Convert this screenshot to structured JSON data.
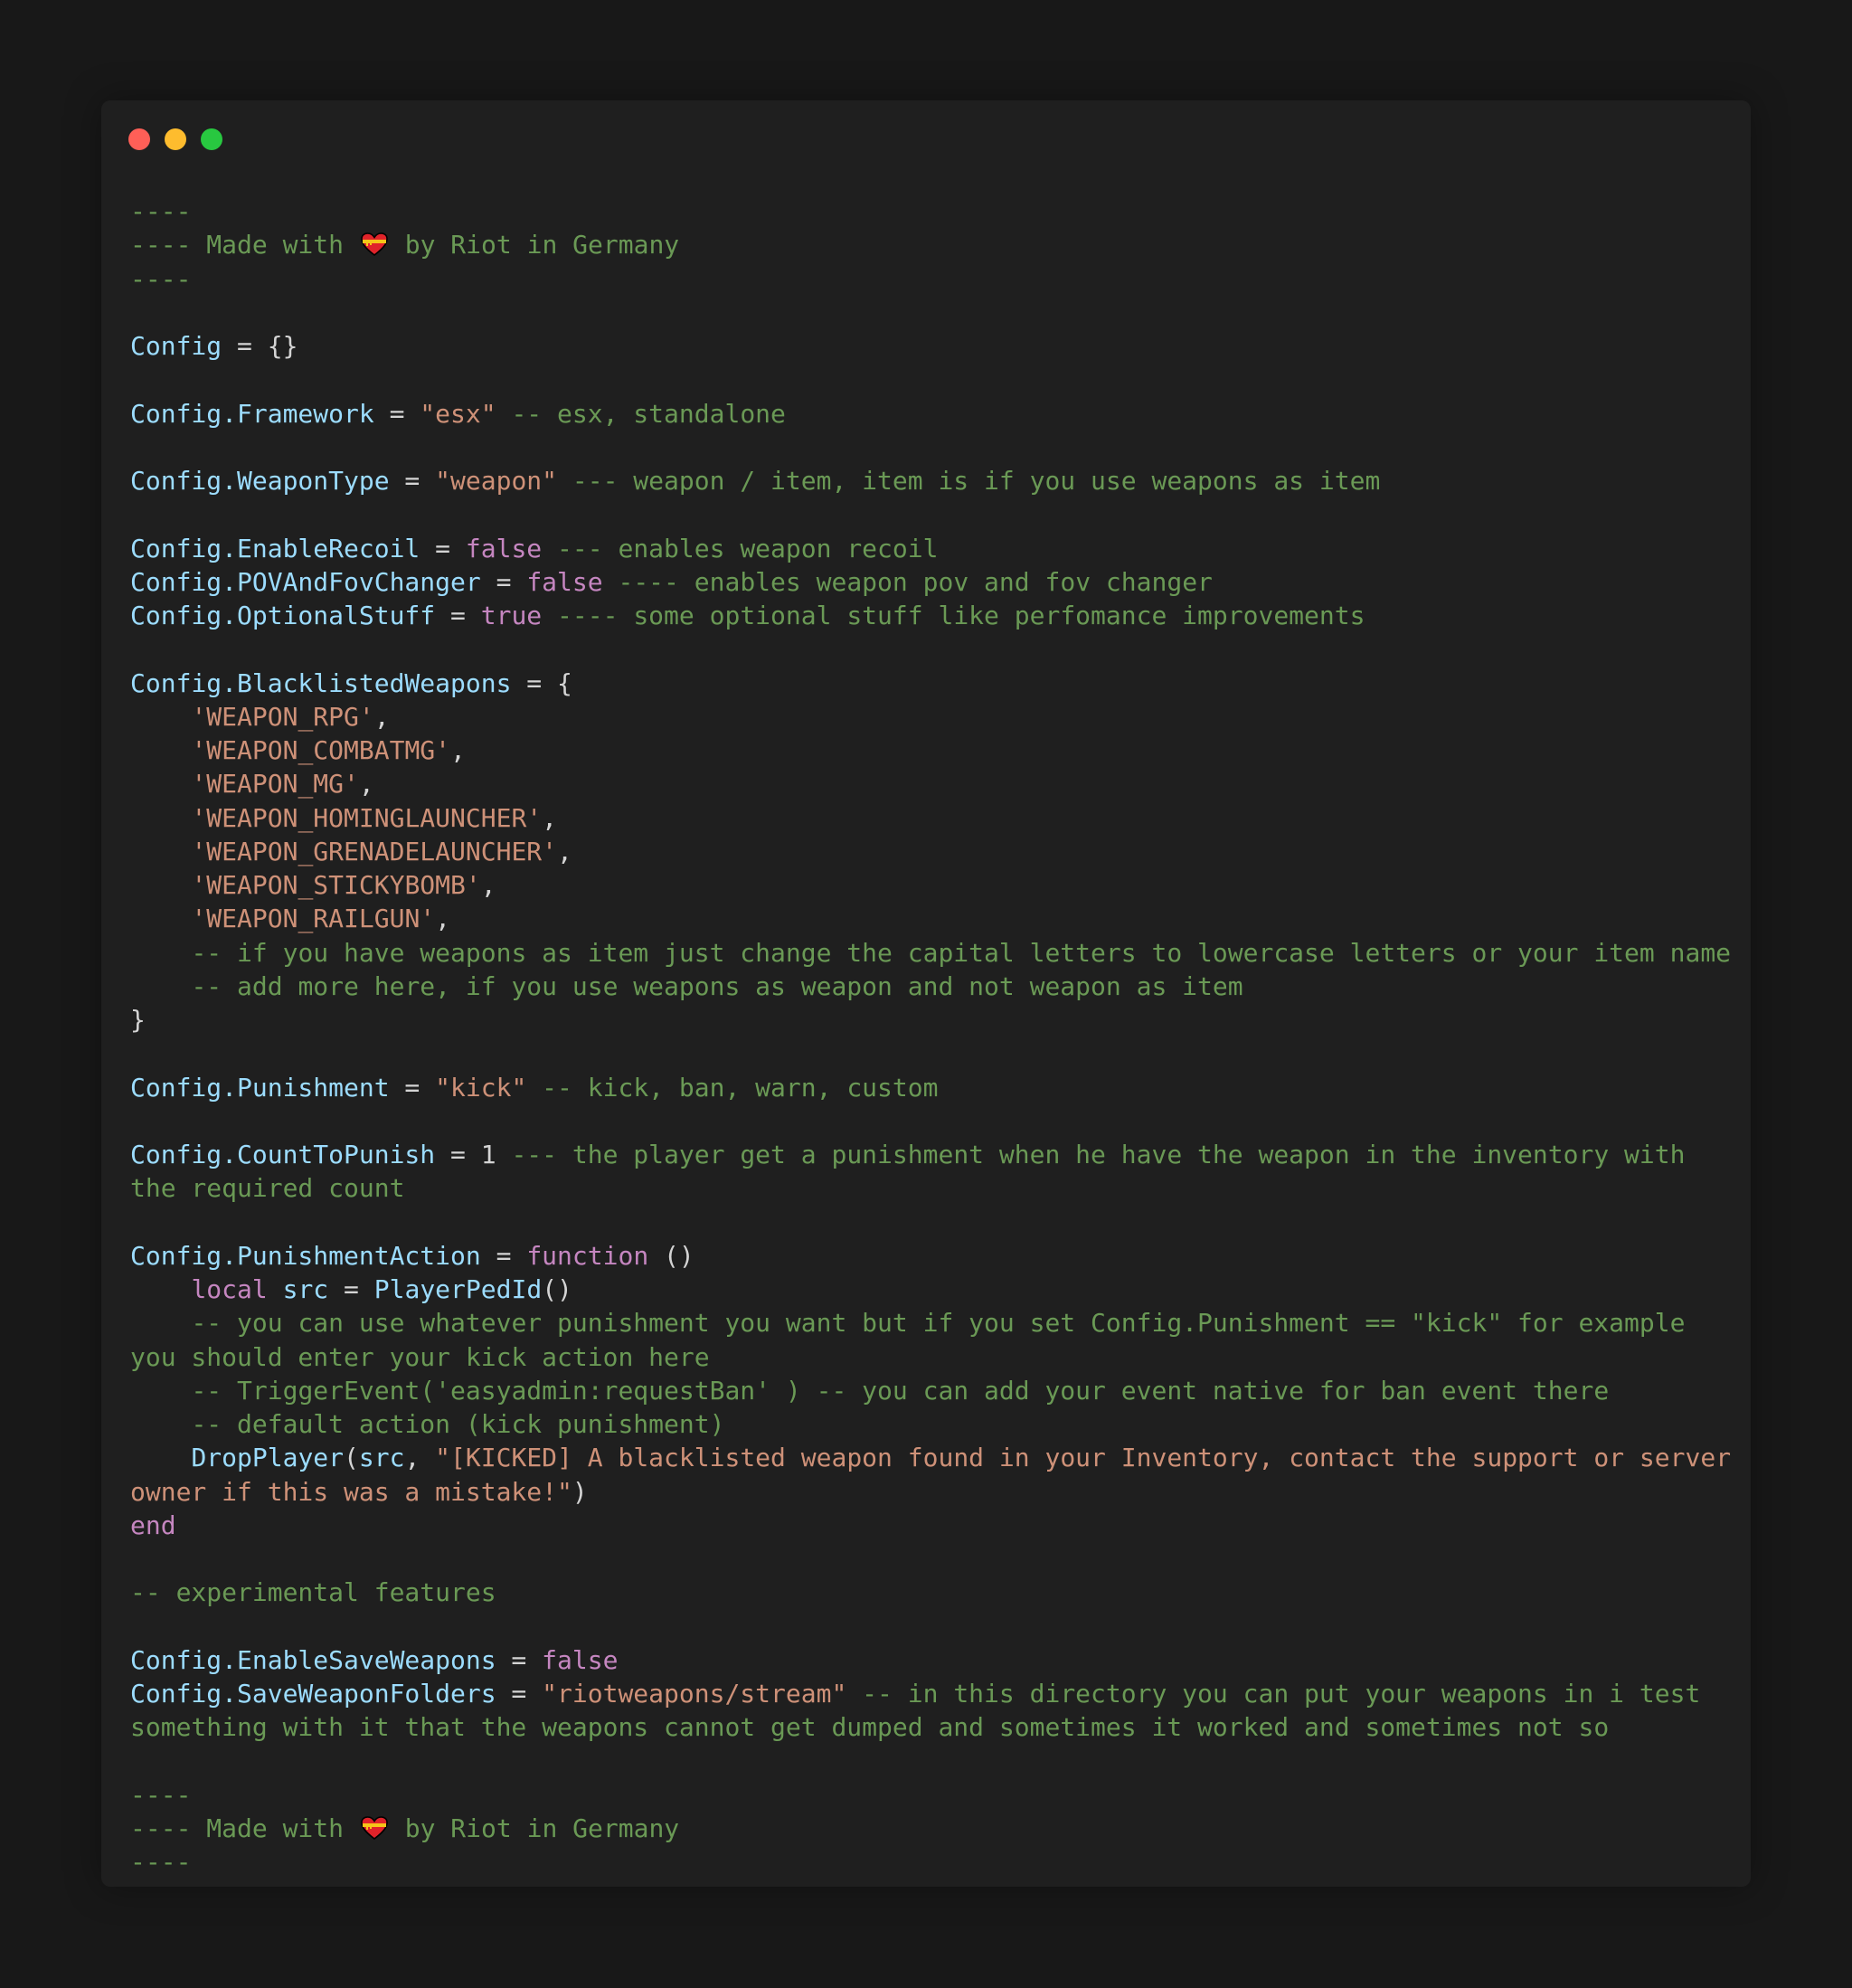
{
  "window": {
    "controls": [
      "close",
      "minimize",
      "maximize"
    ],
    "colors": {
      "close": "#ff5f57",
      "minimize": "#febc2e",
      "maximize": "#28c840",
      "background": "#1f1f1f"
    }
  },
  "syntax_colors": {
    "comment": "#6a9955",
    "variable": "#9cdcfe",
    "string": "#ce9178",
    "keyword": "#c586c0",
    "plain": "#d4d4d4"
  },
  "code": {
    "lines": [
      [
        [
          "c",
          "----"
        ]
      ],
      [
        [
          "c",
          "---- Made with "
        ],
        [
          "e",
          "❤️‍🩹"
        ],
        [
          "c",
          " by Riot in Germany"
        ]
      ],
      [
        [
          "c",
          "----"
        ]
      ],
      [],
      [
        [
          "v",
          "Config"
        ],
        [
          "p",
          " = {}"
        ]
      ],
      [],
      [
        [
          "v",
          "Config.Framework"
        ],
        [
          "p",
          " = "
        ],
        [
          "s",
          "\"esx\""
        ],
        [
          "c",
          " -- esx, standalone"
        ]
      ],
      [],
      [
        [
          "v",
          "Config.WeaponType"
        ],
        [
          "p",
          " = "
        ],
        [
          "s",
          "\"weapon\""
        ],
        [
          "c",
          " --- weapon / item, item is if you use weapons as item"
        ]
      ],
      [],
      [
        [
          "v",
          "Config.EnableRecoil"
        ],
        [
          "p",
          " = "
        ],
        [
          "k",
          "false"
        ],
        [
          "c",
          " --- enables weapon recoil"
        ]
      ],
      [
        [
          "v",
          "Config.POVAndFovChanger"
        ],
        [
          "p",
          " = "
        ],
        [
          "k",
          "false"
        ],
        [
          "c",
          " ---- enables weapon pov and fov changer"
        ]
      ],
      [
        [
          "v",
          "Config.OptionalStuff"
        ],
        [
          "p",
          " = "
        ],
        [
          "k",
          "true"
        ],
        [
          "c",
          " ---- some optional stuff like perfomance improvements"
        ]
      ],
      [],
      [
        [
          "v",
          "Config.BlacklistedWeapons"
        ],
        [
          "p",
          " = {"
        ]
      ],
      [
        [
          "p",
          "    "
        ],
        [
          "s",
          "'WEAPON_RPG'"
        ],
        [
          "p",
          ","
        ]
      ],
      [
        [
          "p",
          "    "
        ],
        [
          "s",
          "'WEAPON_COMBATMG'"
        ],
        [
          "p",
          ","
        ]
      ],
      [
        [
          "p",
          "    "
        ],
        [
          "s",
          "'WEAPON_MG'"
        ],
        [
          "p",
          ","
        ]
      ],
      [
        [
          "p",
          "    "
        ],
        [
          "s",
          "'WEAPON_HOMINGLAUNCHER'"
        ],
        [
          "p",
          ","
        ]
      ],
      [
        [
          "p",
          "    "
        ],
        [
          "s",
          "'WEAPON_GRENADELAUNCHER'"
        ],
        [
          "p",
          ","
        ]
      ],
      [
        [
          "p",
          "    "
        ],
        [
          "s",
          "'WEAPON_STICKYBOMB'"
        ],
        [
          "p",
          ","
        ]
      ],
      [
        [
          "p",
          "    "
        ],
        [
          "s",
          "'WEAPON_RAILGUN'"
        ],
        [
          "p",
          ","
        ]
      ],
      [
        [
          "p",
          "    "
        ],
        [
          "c",
          "-- if you have weapons as item just change the capital letters to lowercase letters or your item name"
        ]
      ],
      [
        [
          "p",
          "    "
        ],
        [
          "c",
          "-- add more here, if you use weapons as weapon and not weapon as item"
        ]
      ],
      [
        [
          "p",
          "}"
        ]
      ],
      [],
      [
        [
          "v",
          "Config.Punishment"
        ],
        [
          "p",
          " = "
        ],
        [
          "s",
          "\"kick\""
        ],
        [
          "c",
          " -- kick, ban, warn, custom"
        ]
      ],
      [],
      [
        [
          "v",
          "Config.CountToPunish"
        ],
        [
          "p",
          " = "
        ],
        [
          "n",
          "1"
        ],
        [
          "c",
          " --- the player get a punishment when he have the weapon in the inventory with"
        ]
      ],
      [
        [
          "c",
          "the required count"
        ]
      ],
      [],
      [
        [
          "v",
          "Config.PunishmentAction"
        ],
        [
          "p",
          " = "
        ],
        [
          "k",
          "function"
        ],
        [
          "p",
          " ()"
        ]
      ],
      [
        [
          "p",
          "    "
        ],
        [
          "k",
          "local"
        ],
        [
          "p",
          " "
        ],
        [
          "v",
          "src"
        ],
        [
          "p",
          " = "
        ],
        [
          "v",
          "PlayerPedId"
        ],
        [
          "p",
          "()"
        ]
      ],
      [
        [
          "p",
          "    "
        ],
        [
          "c",
          "-- you can use whatever punishment you want but if you set Config.Punishment == \"kick\" for example"
        ]
      ],
      [
        [
          "c",
          "you should enter your kick action here"
        ]
      ],
      [
        [
          "p",
          "    "
        ],
        [
          "c",
          "-- TriggerEvent('easyadmin:requestBan' ) -- you can add your event native for ban event there"
        ]
      ],
      [
        [
          "p",
          "    "
        ],
        [
          "c",
          "-- default action (kick punishment)"
        ]
      ],
      [
        [
          "p",
          "    "
        ],
        [
          "v",
          "DropPlayer"
        ],
        [
          "p",
          "("
        ],
        [
          "v",
          "src"
        ],
        [
          "p",
          ", "
        ],
        [
          "s",
          "\"[KICKED] A blacklisted weapon found in your Inventory, contact the support or server"
        ]
      ],
      [
        [
          "s",
          "owner if this was a mistake!\""
        ],
        [
          "p",
          ")"
        ]
      ],
      [
        [
          "k",
          "end"
        ]
      ],
      [],
      [
        [
          "c",
          "-- experimental features"
        ]
      ],
      [],
      [
        [
          "v",
          "Config.EnableSaveWeapons"
        ],
        [
          "p",
          " = "
        ],
        [
          "k",
          "false"
        ]
      ],
      [
        [
          "v",
          "Config.SaveWeaponFolders"
        ],
        [
          "p",
          " = "
        ],
        [
          "s",
          "\"riotweapons/stream\""
        ],
        [
          "c",
          " -- in this directory you can put your weapons in i test"
        ]
      ],
      [
        [
          "c",
          "something with it that the weapons cannot get dumped and sometimes it worked and sometimes not so"
        ]
      ],
      [],
      [
        [
          "c",
          "----"
        ]
      ],
      [
        [
          "c",
          "---- Made with "
        ],
        [
          "e",
          "❤️‍🩹"
        ],
        [
          "c",
          " by Riot in Germany"
        ]
      ],
      [
        [
          "c",
          "----"
        ]
      ]
    ]
  }
}
